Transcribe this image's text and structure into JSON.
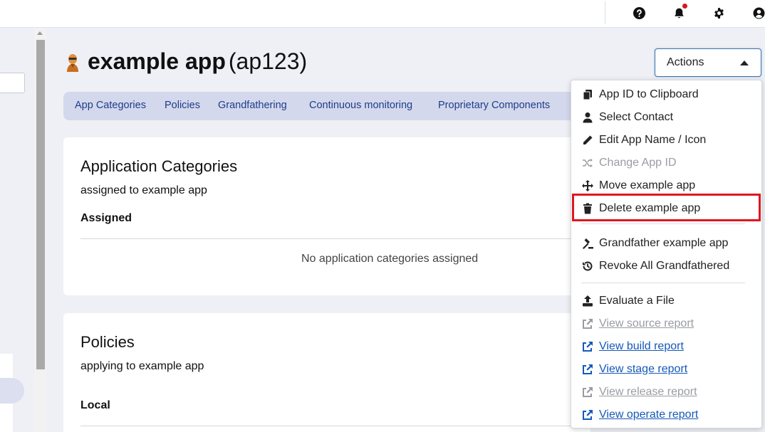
{
  "header": {
    "icons": [
      "help-icon",
      "bell-icon",
      "gear-icon",
      "user-icon"
    ],
    "has_notification": true
  },
  "app": {
    "name": "example app",
    "id_display": "(ap123)",
    "icon": "app-avatar-icon"
  },
  "actions_button": {
    "label": "Actions"
  },
  "tabs": [
    {
      "label": "App Categories"
    },
    {
      "label": "Policies"
    },
    {
      "label": "Grandfathering"
    },
    {
      "label": "Continuous monitoring"
    },
    {
      "label": "Proprietary Components"
    }
  ],
  "categories_card": {
    "title": "Application Categories",
    "subtitle": "assigned to example app",
    "column": "Assigned",
    "empty_text": "No application categories assigned"
  },
  "policies_card": {
    "title": "Policies",
    "subtitle": "applying to example app",
    "column": "Local"
  },
  "menu": {
    "items": [
      {
        "label": "App ID to Clipboard",
        "icon": "clipboard-icon",
        "disabled": false
      },
      {
        "label": "Select Contact",
        "icon": "user-icon",
        "disabled": false
      },
      {
        "label": "Edit App Name / Icon",
        "icon": "pencil-icon",
        "disabled": false
      },
      {
        "label": "Change App ID",
        "icon": "shuffle-icon",
        "disabled": true
      },
      {
        "label": "Move example app",
        "icon": "move-icon",
        "disabled": false
      },
      {
        "label": "Delete example app",
        "icon": "trash-icon",
        "disabled": false,
        "highlighted": true
      },
      {
        "label": "Grandfather example app",
        "icon": "gavel-icon",
        "disabled": false
      },
      {
        "label": "Revoke All Grandfathered",
        "icon": "history-icon",
        "disabled": false
      },
      {
        "label": "Evaluate a File",
        "icon": "upload-icon",
        "disabled": false
      },
      {
        "label": "View source report",
        "icon": "external-link-icon",
        "disabled": true,
        "link": true
      },
      {
        "label": "View build report",
        "icon": "external-link-icon",
        "disabled": false,
        "link": true
      },
      {
        "label": "View stage report",
        "icon": "external-link-icon",
        "disabled": false,
        "link": true
      },
      {
        "label": "View release report",
        "icon": "external-link-icon",
        "disabled": true,
        "link": true
      },
      {
        "label": "View operate report",
        "icon": "external-link-icon",
        "disabled": false,
        "link": true
      }
    ]
  },
  "colors": {
    "accent": "#1d3d8a",
    "link": "#1559b9",
    "highlight_border": "#e0161f",
    "tab_bar_bg": "#d4d8ec",
    "page_bg": "#eef0f5"
  }
}
